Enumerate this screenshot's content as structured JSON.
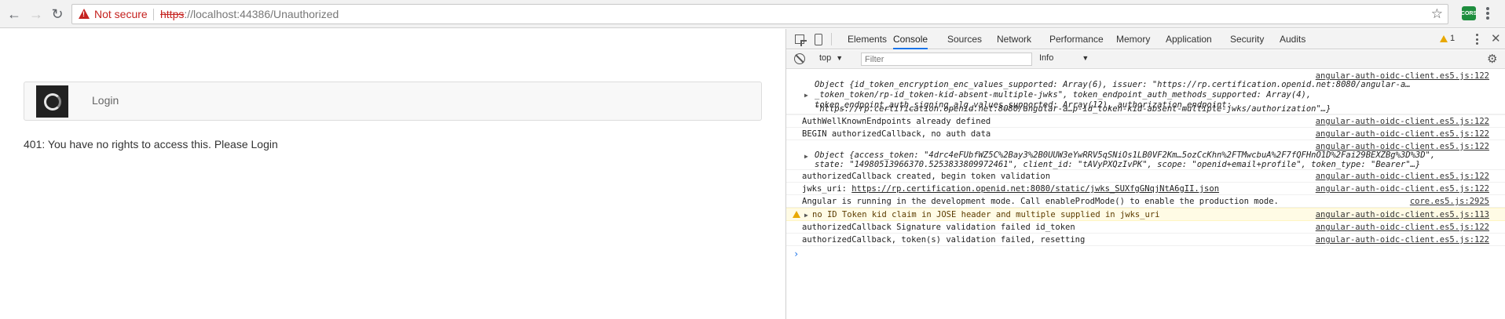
{
  "browser": {
    "security_label": "Not secure",
    "url_scheme": "https",
    "url_rest": "://localhost:44386/Unauthorized",
    "extension_label": "CORS"
  },
  "page": {
    "login_label": "Login",
    "message": "401: You have no rights to access this. Please Login"
  },
  "devtools": {
    "tabs": [
      "Elements",
      "Console",
      "Sources",
      "Network",
      "Performance",
      "Memory",
      "Application",
      "Security",
      "Audits"
    ],
    "active_tab": "Console",
    "warning_count": "1",
    "context": "top",
    "filter_placeholder": "Filter",
    "level": "Info",
    "log": [
      {
        "source": "angular-auth-oidc-client.es5.js:122",
        "object_lines": [
          "Object {id_token_encryption_enc_values_supported: Array(6), issuer: \"https://rp.certification.openid.net:8080/angular-a…",
          "_token_token/rp-id_token-kid-absent-multiple-jwks\", token_endpoint_auth_methods_supported: Array(4),",
          "token_endpoint_auth_signing_alg_values_supported: Array(12), authorization_endpoint:",
          "\"https://rp.certification.openid.net:8080/angular-a…p-id_token-kid-absent-multiple-jwks/authorization\"…}"
        ]
      },
      {
        "source": "angular-auth-oidc-client.es5.js:122",
        "text": "AuthWellKnownEndpoints already defined"
      },
      {
        "source": "angular-auth-oidc-client.es5.js:122",
        "text": "BEGIN authorizedCallback, no auth data"
      },
      {
        "source": "angular-auth-oidc-client.es5.js:122",
        "object_lines": [
          "Object {access_token: \"4drc4eFUbfWZ5C%2Bay3%2B0UUW3eYwRRV5qSNiOs1LB0VF2Km…5ozCcKhn%2FTMwcbuA%2F7fQFHnO1D%2Fai29BEXZBg%3D%3D\",",
          "state: \"14980513966370.5253833809972461\", client_id: \"tAVyPXQzIvPK\", scope: \"openid+email+profile\", token_type: \"Bearer\"…}"
        ]
      },
      {
        "source": "angular-auth-oidc-client.es5.js:122",
        "text": "authorizedCallback created, begin token validation"
      },
      {
        "source": "angular-auth-oidc-client.es5.js:122",
        "text_prefix": "jwks_uri: ",
        "link": "https://rp.certification.openid.net:8080/static/jwks_SUXfgGNqjNtA6gII.json"
      },
      {
        "source": "core.es5.js:2925",
        "text": "Angular is running in the development mode. Call enableProdMode() to enable the production mode."
      },
      {
        "source": "angular-auth-oidc-client.es5.js:113",
        "text": "no ID Token kid claim in JOSE header and multiple supplied in jwks_uri",
        "level": "warning"
      },
      {
        "source": "angular-auth-oidc-client.es5.js:122",
        "text": "authorizedCallback Signature validation failed id_token"
      },
      {
        "source": "angular-auth-oidc-client.es5.js:122",
        "text": "authorizedCallback, token(s) validation failed, resetting"
      }
    ]
  }
}
